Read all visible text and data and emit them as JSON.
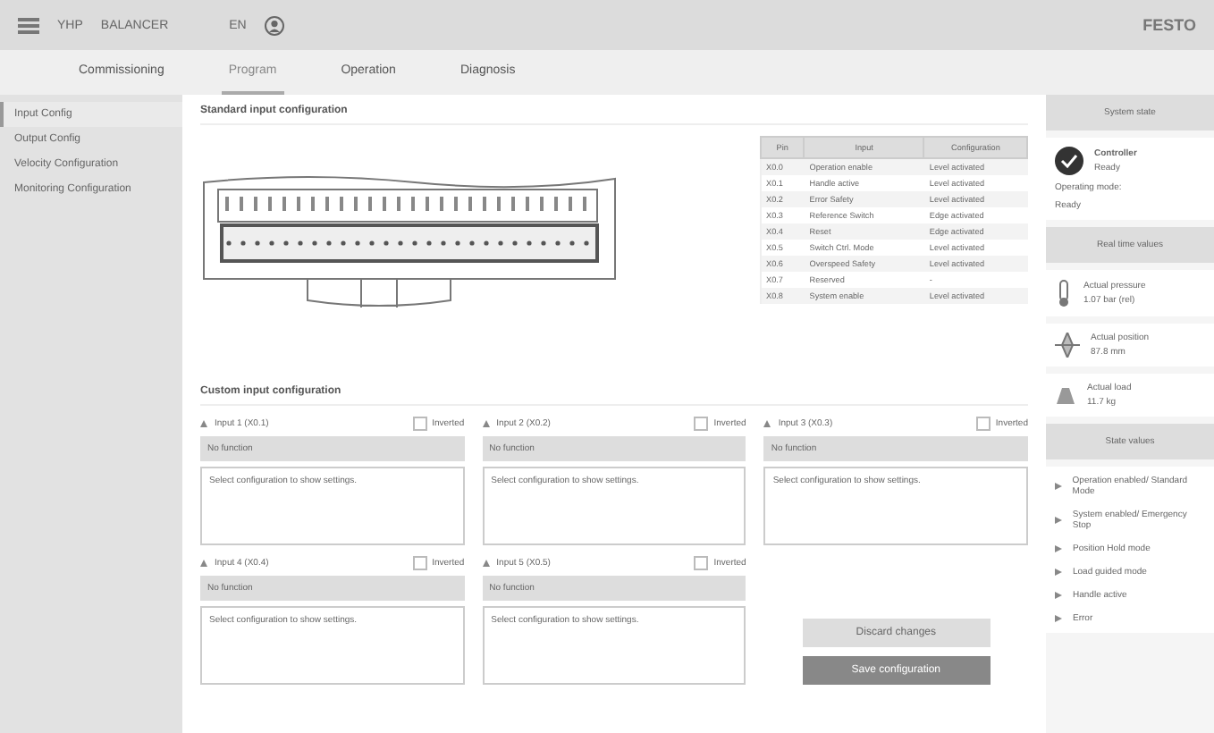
{
  "header": {
    "product": "YHP",
    "title": "BALANCER",
    "language": "EN",
    "logo": "FESTO"
  },
  "tabs": [
    {
      "label": "Commissioning",
      "selected": false
    },
    {
      "label": "Program",
      "selected": true
    },
    {
      "label": "Operation",
      "selected": false
    },
    {
      "label": "Diagnosis",
      "selected": false
    }
  ],
  "sidebar": {
    "items": [
      {
        "label": "Input Config",
        "selected": true
      },
      {
        "label": "Output Config",
        "selected": false
      },
      {
        "label": "Velocity Configuration",
        "selected": false
      },
      {
        "label": "Monitoring Configuration",
        "selected": false
      }
    ]
  },
  "standard": {
    "title": "Standard input configuration",
    "table": {
      "columns": [
        "Pin",
        "Input",
        "Configuration"
      ],
      "rows": [
        [
          "X0.0",
          "Operation enable",
          "Level activated"
        ],
        [
          "X0.1",
          "Handle active",
          "Level activated"
        ],
        [
          "X0.2",
          "Error Safety",
          "Level activated"
        ],
        [
          "X0.3",
          "Reference Switch",
          "Edge activated"
        ],
        [
          "X0.4",
          "Reset",
          "Edge activated"
        ],
        [
          "X0.5",
          "Switch Ctrl. Mode",
          "Level activated"
        ],
        [
          "X0.6",
          "Overspeed Safety",
          "Level activated"
        ],
        [
          "X0.7",
          "Reserved",
          "-"
        ],
        [
          "X0.8",
          "System enable",
          "Level activated"
        ]
      ]
    }
  },
  "custom": {
    "title": "Custom input configuration",
    "inputs": [
      {
        "label": "Input 1 (X0.1)",
        "inverted_label": "Inverted",
        "inverted": false,
        "function": "No function",
        "hint": "Select configuration to show settings."
      },
      {
        "label": "Input 2 (X0.2)",
        "inverted_label": "Inverted",
        "inverted": false,
        "function": "No function",
        "hint": "Select configuration to show settings."
      },
      {
        "label": "Input 3 (X0.3)",
        "inverted_label": "Inverted",
        "inverted": false,
        "function": "No function",
        "hint": "Select configuration to show settings."
      },
      {
        "label": "Input 4 (X0.4)",
        "inverted_label": "Inverted",
        "inverted": false,
        "function": "No function",
        "hint": "Select configuration to show settings."
      },
      {
        "label": "Input 5 (X0.5)",
        "inverted_label": "Inverted",
        "inverted": false,
        "function": "No function",
        "hint": "Select configuration to show settings."
      }
    ],
    "buttons": [
      "Discard changes",
      "Save configuration"
    ]
  },
  "system_state": {
    "title": "System state",
    "name": "Controller",
    "status": "Ready",
    "mode_label": "Operating mode:",
    "mode": "Ready"
  },
  "real_time": {
    "title": "Real time values",
    "values": [
      {
        "kind": "pressure",
        "label": "Actual pressure",
        "value": "1.07 bar (rel)"
      },
      {
        "kind": "position",
        "label": "Actual position",
        "value": "87.8 mm"
      },
      {
        "kind": "load",
        "label": "Actual load",
        "value": "11.7 kg"
      }
    ]
  },
  "state_values": {
    "title": "State values",
    "items": [
      "Operation enabled/ Standard Mode",
      "System enabled/ Emergency Stop",
      "Position Hold mode",
      "Load guided mode",
      "Handle active",
      "Error"
    ]
  }
}
